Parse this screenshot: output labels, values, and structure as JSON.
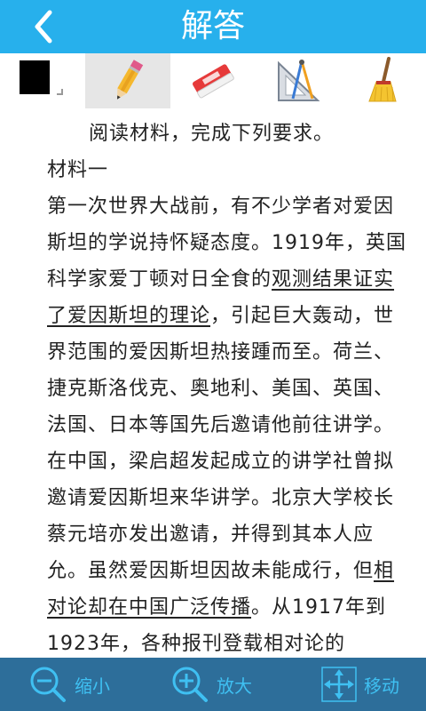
{
  "header": {
    "title": "解答",
    "back_icon": "chevron-left-icon"
  },
  "toolbar": {
    "tools": [
      {
        "name": "color",
        "icon": "color-swatch-icon",
        "color": "#000000"
      },
      {
        "name": "pencil",
        "icon": "pencil-icon",
        "selected": true
      },
      {
        "name": "eraser",
        "icon": "eraser-icon"
      },
      {
        "name": "geometry",
        "icon": "ruler-compass-icon"
      },
      {
        "name": "broom",
        "icon": "broom-icon"
      }
    ]
  },
  "content": {
    "instruction": "阅读材料，完成下列要求。",
    "material_title": "材料一",
    "p1_a": "第一次世界大战前，有不少学者对爱因斯坦的学说持怀疑态度。1919年，英国科学家爱丁顿对日全食的",
    "p1_u1": "观测结果证实了爱因斯坦的理论",
    "p1_b": "，引起巨大轰动，世界范围的爱因斯坦热接踵而至。荷兰、捷克斯洛伐克、奥地利、美国、英国、法国、日本等国先后邀请他前往讲学。在中国，梁启超发起成立的讲学社曾拟邀请爱因斯坦来华讲学。北京大学校长蔡元培亦发出邀请，并得到其本人应允。虽然爱因斯坦因故未能成行，但",
    "p1_u2": "相对论却在中国广泛传播",
    "p1_c": "。从1917年到1923年，各种报刊登载相对论的"
  },
  "bottom": {
    "zoom_out_label": "缩小",
    "zoom_in_label": "放大",
    "move_label": "移动"
  },
  "colors": {
    "header_bg": "#27b0ec",
    "bottom_bg": "#2d6e9a",
    "bottom_text": "#3fc0f2"
  }
}
